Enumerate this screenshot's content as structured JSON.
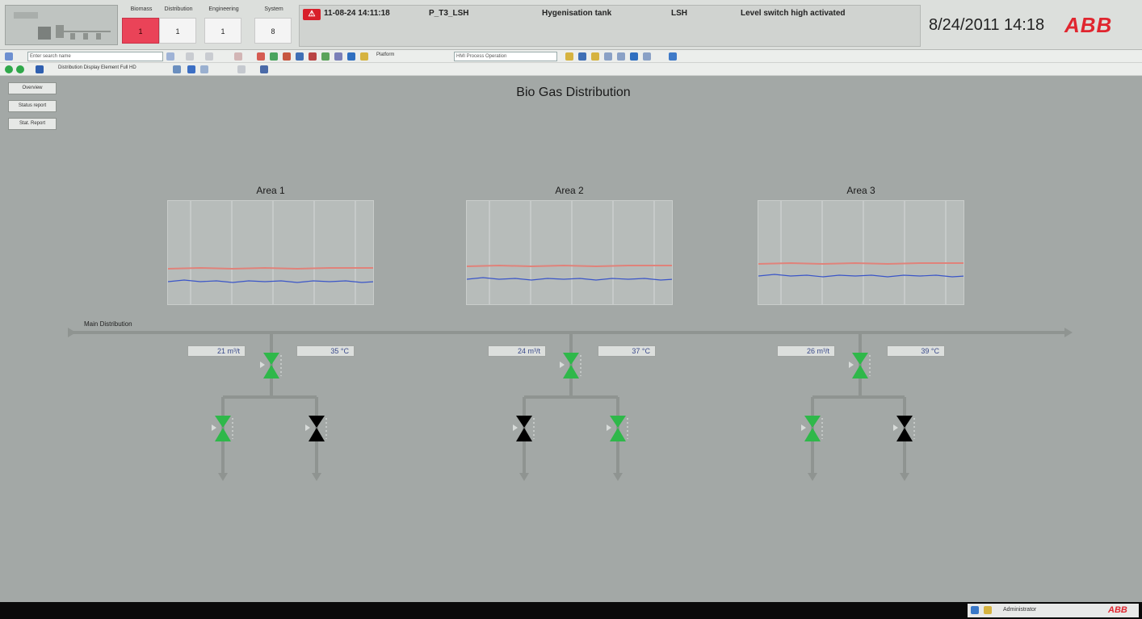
{
  "header": {
    "alarm_groups": [
      {
        "label": "Biomass",
        "count": "1",
        "active": true
      },
      {
        "label": "Distribution",
        "count": "1",
        "active": false
      },
      {
        "label": "Engineering",
        "count": "1",
        "active": false
      },
      {
        "label": "System",
        "count": "8",
        "active": false
      }
    ],
    "latest_alarm": {
      "timestamp": "11-08-24 14:11:18",
      "object": "P_T3_LSH",
      "description": "Hygenisation tank",
      "condition": "LSH",
      "message": "Level switch high activated"
    },
    "clock": "8/24/2011 14:18",
    "logo": "ABB"
  },
  "toolbar": {
    "search_placeholder": "Enter search name",
    "workplace_label": "Platform",
    "workplace_value": "HMI Process Operation",
    "display_element": "Distribution Display Element Full HD"
  },
  "nav_buttons": [
    "Overview",
    "Status report",
    "Stat. Report"
  ],
  "display": {
    "title": "Bio Gas Distribution",
    "main_line_label": "Main Distribution",
    "areas": [
      {
        "name": "Area 1",
        "flow": "21 m³/t",
        "temp": "35 °C",
        "main_valve": "open",
        "branch_valves": [
          "open",
          "closed"
        ]
      },
      {
        "name": "Area 2",
        "flow": "24 m³/t",
        "temp": "37 °C",
        "main_valve": "open",
        "branch_valves": [
          "closed",
          "open"
        ]
      },
      {
        "name": "Area 3",
        "flow": "26 m³/t",
        "temp": "39 °C",
        "main_valve": "open",
        "branch_valves": [
          "open",
          "closed"
        ]
      }
    ]
  },
  "colors": {
    "valve_open": "#2fb84a",
    "valve_closed": "#000000",
    "alarm_active": "#ea4358",
    "trend_flow": "#3a55c8",
    "trend_temp": "#e0827a",
    "brand": "#e0262f"
  },
  "taskbar": {
    "user": "Administrator",
    "logo": "ABB"
  }
}
